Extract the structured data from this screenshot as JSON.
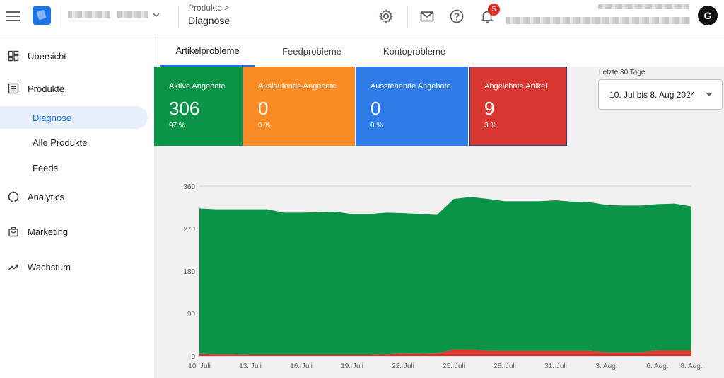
{
  "header": {
    "breadcrumb_parent": "Produkte >",
    "breadcrumb_current": "Diagnose",
    "notification_count": "5",
    "avatar_letter": "G"
  },
  "sidebar": {
    "items": [
      {
        "label": "Übersicht",
        "icon": "dashboard-icon"
      },
      {
        "label": "Produkte",
        "icon": "list-icon"
      },
      {
        "label": "Diagnose",
        "icon": "",
        "active": true
      },
      {
        "label": "Alle Produkte",
        "icon": ""
      },
      {
        "label": "Feeds",
        "icon": ""
      },
      {
        "label": "Analytics",
        "icon": "analytics-icon"
      },
      {
        "label": "Marketing",
        "icon": "shopping-bag-icon"
      },
      {
        "label": "Wachstum",
        "icon": "trending-up-icon"
      }
    ]
  },
  "tabs": [
    {
      "label": "Artikelprobleme",
      "active": true
    },
    {
      "label": "Feedprobleme",
      "active": false
    },
    {
      "label": "Kontoprobleme",
      "active": false
    }
  ],
  "cards": [
    {
      "label": "Aktive Angebote",
      "value": "306",
      "pct": "97 %",
      "color": "#0b9347"
    },
    {
      "label": "Auslaufende Angebote",
      "value": "0",
      "pct": "0 %",
      "color": "#fb8c25"
    },
    {
      "label": "Ausstehende Angebote",
      "value": "0",
      "pct": "0 %",
      "color": "#2f7ce9"
    },
    {
      "label": "Abgelehnte Artikel",
      "value": "9",
      "pct": "3 %",
      "color": "#d83831"
    }
  ],
  "date_range": {
    "caption": "Letzte 30 Tage",
    "value": "10. Jul bis 8. Aug 2024"
  },
  "chart_data": {
    "type": "area",
    "stacked": true,
    "ylim": [
      0,
      360
    ],
    "yticks": [
      0,
      90,
      180,
      270,
      360
    ],
    "xtick_labels": [
      "10. Juli",
      "13. Juli",
      "16. Juli",
      "19. Juli",
      "22. Juli",
      "25. Juli",
      "28. Juli",
      "31. Juli",
      "3. Aug.",
      "6. Aug.",
      "8. Aug."
    ],
    "x": [
      "10. Juli",
      "11. Juli",
      "12. Juli",
      "13. Juli",
      "14. Juli",
      "15. Juli",
      "16. Juli",
      "17. Juli",
      "18. Juli",
      "19. Juli",
      "20. Juli",
      "21. Juli",
      "22. Juli",
      "23. Juli",
      "24. Juli",
      "25. Juli",
      "26. Juli",
      "27. Juli",
      "28. Juli",
      "29. Juli",
      "30. Juli",
      "31. Juli",
      "1. Aug.",
      "2. Aug.",
      "3. Aug.",
      "4. Aug.",
      "5. Aug.",
      "6. Aug.",
      "7. Aug.",
      "8. Aug."
    ],
    "series": [
      {
        "color": "#d83831",
        "values": [
          5,
          4,
          4,
          3,
          3,
          3,
          3,
          3,
          3,
          3,
          3,
          4,
          6,
          5,
          6,
          14,
          14,
          11,
          11,
          11,
          11,
          11,
          11,
          11,
          8,
          8,
          8,
          12,
          12,
          12
        ]
      },
      {
        "color": "#0b9347",
        "values": [
          308,
          307,
          307,
          308,
          308,
          301,
          301,
          302,
          303,
          298,
          298,
          300,
          297,
          296,
          293,
          319,
          323,
          322,
          317,
          317,
          317,
          319,
          316,
          315,
          312,
          311,
          311,
          310,
          311,
          305
        ]
      }
    ]
  }
}
